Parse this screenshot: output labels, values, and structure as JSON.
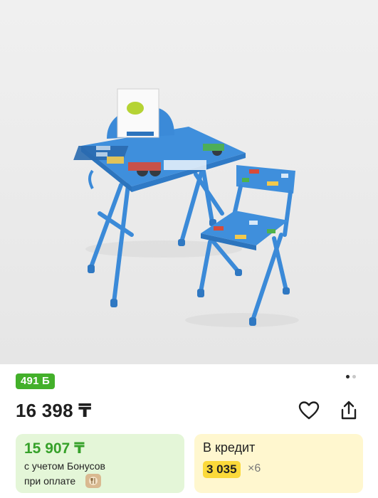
{
  "product": {
    "image_icon": "kids-desk-and-chair-photo",
    "bonus_badge": "491 Б",
    "price": "16 398 ₸",
    "favorite_icon": "heart-icon",
    "share_icon": "share-icon",
    "carousel": {
      "total": 2,
      "active": 1
    }
  },
  "bonus_card": {
    "price": "15 907 ₸",
    "line1": "с учетом Бонусов",
    "line2": "при оплате"
  },
  "credit_card": {
    "title": "В кредит",
    "monthly": "3 035",
    "months": "×6"
  },
  "colors": {
    "bonus_green": "#43b02a",
    "credit_yellow": "#fbd93a",
    "furniture_blue": "#3a86d6"
  }
}
